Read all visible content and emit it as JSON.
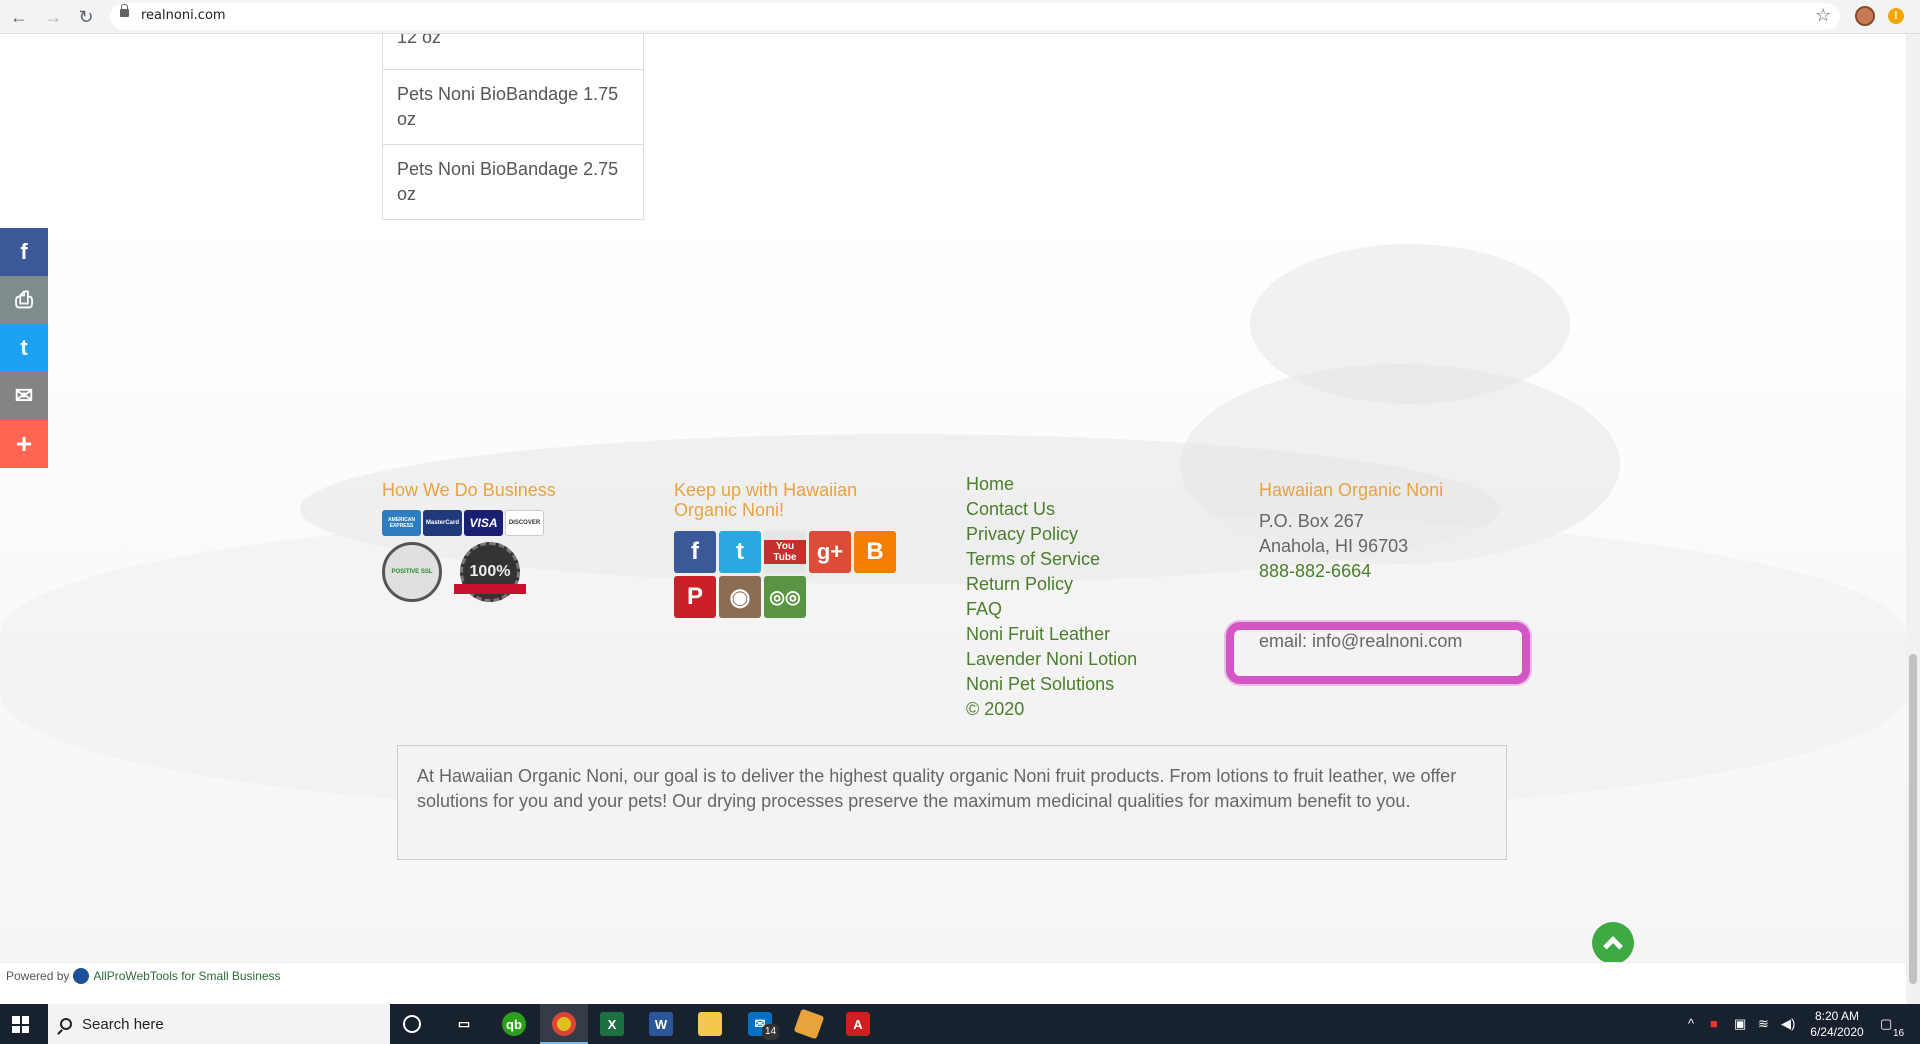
{
  "browser": {
    "url": "realnoni.com"
  },
  "products": {
    "items": [
      "12 oz",
      "Pets Noni BioBandage 1.75 oz",
      "Pets Noni BioBandage 2.75 oz"
    ]
  },
  "share": {
    "icons": [
      "facebook-icon",
      "print-icon",
      "twitter-icon",
      "email-icon",
      "plus-icon"
    ]
  },
  "footer": {
    "business": {
      "title": "How We Do Business",
      "cards": [
        "AMERICAN EXPRESS",
        "MasterCard",
        "VISA",
        "DISCOVER"
      ],
      "ssl_badge": "POSITIVE SSL",
      "guarantee_badge": "100%"
    },
    "social": {
      "title": "Keep up with Hawaiian Organic Noni!",
      "icons": [
        "facebook-icon",
        "twitter-icon",
        "youtube-icon",
        "google-plus-icon",
        "blogger-icon",
        "pinterest-icon",
        "instagram-icon",
        "tripadvisor-icon"
      ],
      "youtube_label": "You Tube"
    },
    "nav": {
      "links": [
        "Home",
        "Contact Us",
        "Privacy Policy",
        "Terms of Service",
        "Return Policy",
        "FAQ",
        "Noni Fruit Leather",
        "Lavender Noni Lotion",
        "Noni Pet Solutions"
      ],
      "copyright": "© 2020"
    },
    "contact": {
      "title": "Hawaiian Organic Noni",
      "po_box": "P.O. Box 267",
      "city": "Anahola, HI 96703",
      "phone": "888-882-6664",
      "email": "email: info@realnoni.com"
    },
    "about": "At Hawaiian Organic Noni, our goal is to deliver the highest quality organic Noni fruit products. From lotions to fruit leather, we offer solutions for you and your pets! Our drying processes preserve the maximum medicinal qualities for maximum benefit to you.",
    "powered_prefix": "Powered by",
    "powered_link": "AllProWebTools for Small Business"
  },
  "taskbar": {
    "search_placeholder": "Search here",
    "time": "8:20 AM",
    "date": "6/24/2020",
    "mail_count": "14",
    "notification_count": "16"
  },
  "colors": {
    "accent_orange": "#e8a33d",
    "link_green": "#4a7e2b",
    "highlight_pink": "#d456c4",
    "back_top_green": "#3daa44"
  }
}
